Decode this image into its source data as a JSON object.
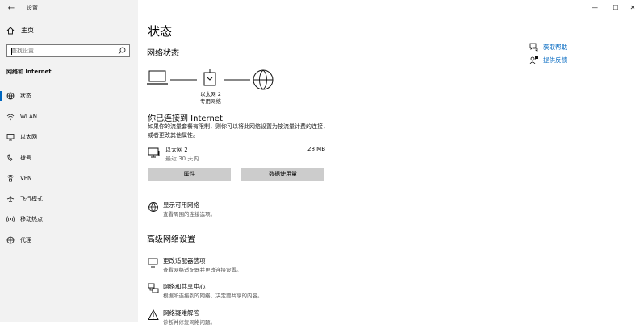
{
  "window": {
    "title": "设置",
    "controls": {
      "minimize": "—",
      "maximize": "☐",
      "close": "✕"
    }
  },
  "sidebar": {
    "home_label": "主页",
    "search_placeholder": "查找设置",
    "section_title": "网络和 Internet",
    "items": [
      {
        "label": "状态",
        "icon": "globe-status-icon",
        "active": true
      },
      {
        "label": "WLAN",
        "icon": "wifi-icon"
      },
      {
        "label": "以太网",
        "icon": "ethernet-icon"
      },
      {
        "label": "拨号",
        "icon": "dialup-phone-icon"
      },
      {
        "label": "VPN",
        "icon": "vpn-icon"
      },
      {
        "label": "飞行模式",
        "icon": "airplane-icon"
      },
      {
        "label": "移动热点",
        "icon": "hotspot-icon"
      },
      {
        "label": "代理",
        "icon": "proxy-globe-icon"
      }
    ]
  },
  "main": {
    "page_title": "状态",
    "network_status_heading": "网络状态",
    "diagram": {
      "adapter_name": "以太网 2",
      "network_type": "专用网络"
    },
    "connected_title": "你已连接到 Internet",
    "connected_desc": "如果你的流量套餐有限制，则你可以将此网络设置为按流量计费的连接，或者更改其他属性。",
    "ethernet": {
      "name": "以太网 2",
      "sub": "最近 30 天内",
      "usage": "28 MB"
    },
    "buttons": {
      "properties": "属性",
      "data_usage": "数据使用量"
    },
    "show_networks": {
      "title": "显示可用网络",
      "desc": "查看周围的连接选项。"
    },
    "advanced_heading": "高级网络设置",
    "advanced": [
      {
        "title": "更改适配器选项",
        "desc": "查看网络适配器并更改连接设置。",
        "icon": "adapter-monitor-icon"
      },
      {
        "title": "网络和共享中心",
        "desc": "根据所连接到的网络，决定要共享的内容。",
        "icon": "sharing-center-icon"
      },
      {
        "title": "网络疑难解答",
        "desc": "诊断并修复网络问题。",
        "icon": "warning-triangle-icon"
      }
    ]
  },
  "help": {
    "get_help": "获取帮助",
    "feedback": "提供反馈"
  },
  "colors": {
    "accent": "#0067c0",
    "sidebar_bg": "#f2f2f2",
    "button_bg": "#cccccc"
  }
}
